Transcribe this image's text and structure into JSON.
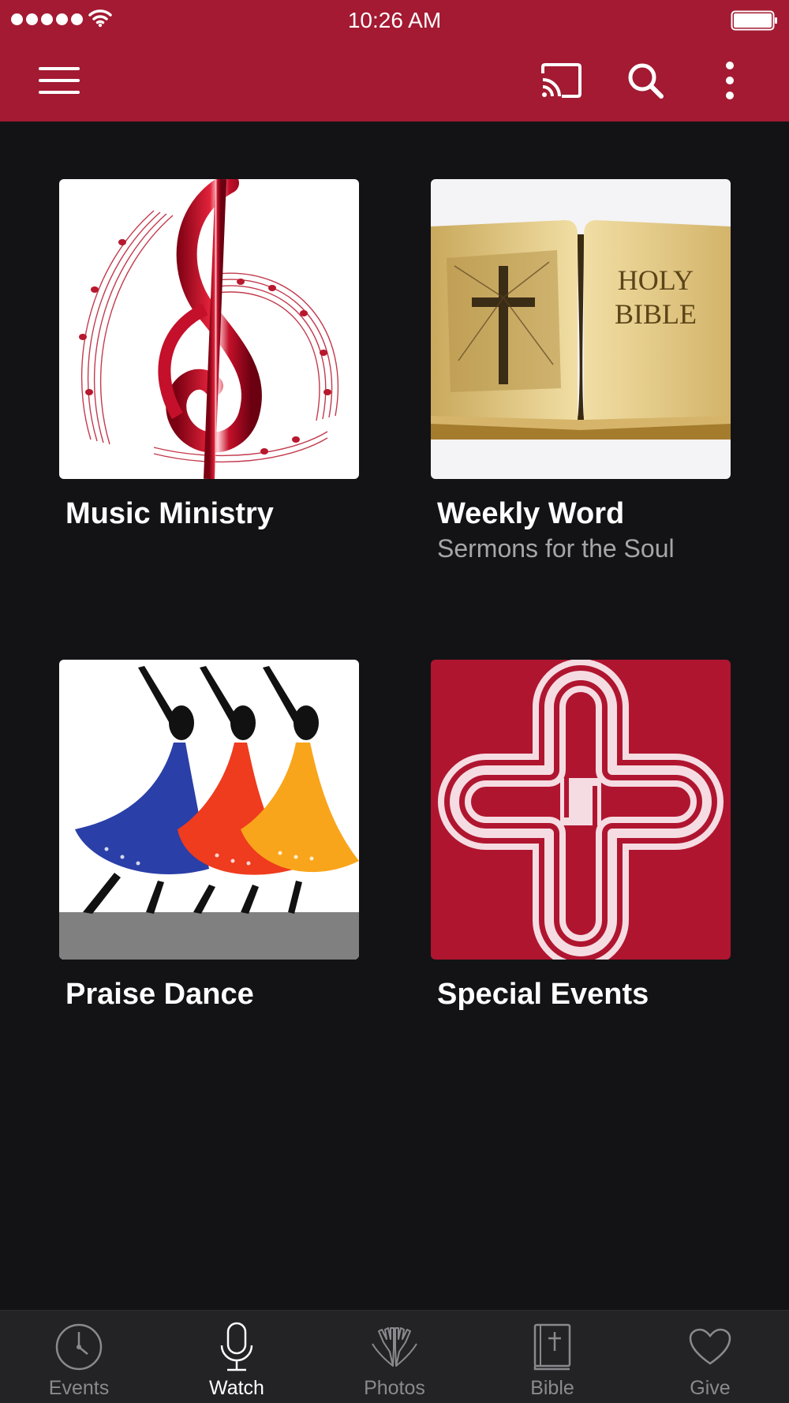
{
  "status_bar": {
    "time": "10:26 AM"
  },
  "toolbar": {
    "menu_icon": "hamburger-menu-icon",
    "cast_icon": "cast-icon",
    "search_icon": "search-icon",
    "more_icon": "more-vertical-icon"
  },
  "colors": {
    "header": "#a31a32",
    "background": "#131316",
    "tab_bar": "#232326",
    "tab_inactive": "#8a8a8e",
    "tab_active": "#ffffff"
  },
  "tiles": [
    {
      "title": "Music Ministry",
      "subtitle": "",
      "image": "treble-clef-image"
    },
    {
      "title": "Weekly Word",
      "subtitle": "Sermons for the Soul",
      "image": "holy-bible-image",
      "image_text": [
        "HOLY",
        "BIBLE"
      ]
    },
    {
      "title": "Praise Dance",
      "subtitle": "",
      "image": "praise-dancers-image"
    },
    {
      "title": "Special Events",
      "subtitle": "",
      "image": "celtic-cross-image"
    }
  ],
  "tabs": [
    {
      "label": "Events",
      "icon": "clock-icon",
      "active": false
    },
    {
      "label": "Watch",
      "icon": "microphone-icon",
      "active": true
    },
    {
      "label": "Photos",
      "icon": "praying-hands-icon",
      "active": false
    },
    {
      "label": "Bible",
      "icon": "bible-icon",
      "active": false
    },
    {
      "label": "Give",
      "icon": "heart-icon",
      "active": false
    }
  ]
}
